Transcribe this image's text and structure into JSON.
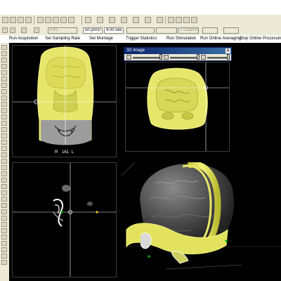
{
  "toolbar2": {
    "edit_placeholder": "Edit...",
    "amplitude_value": "50 µV/cr",
    "time_value": "4.00 sec",
    "columns_value": "1 Column"
  },
  "commands": [
    "Run Acquisition",
    "Set Sampling Rate",
    "Set Montage",
    "Trigger Statistics",
    "Run Stimulation",
    "Run Online Averaging",
    "Stop Online Processing"
  ],
  "window_3d": {
    "title": "3D Image",
    "close_glyph": "x"
  },
  "coronal": {
    "orientation_left": "R",
    "slice_number": "161",
    "orientation_right": "L"
  },
  "colors": {
    "brain_yellow": "#e8e86a",
    "head_outline": "#f0f070",
    "skull_gray": "#a8a8a8",
    "crosshair": "#ffffff",
    "window_title": "#0a246a"
  }
}
